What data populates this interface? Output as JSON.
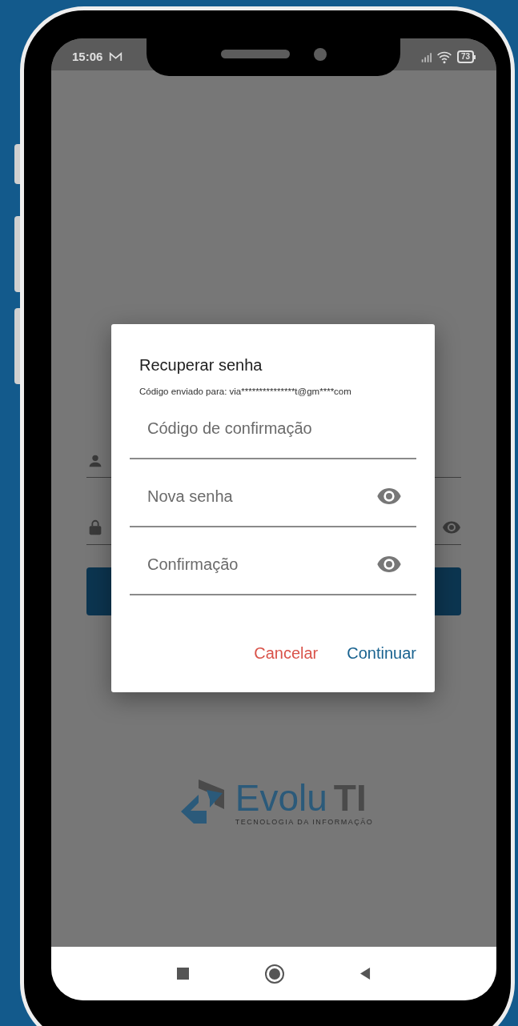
{
  "status_bar": {
    "time": "15:06",
    "battery": "73"
  },
  "dialog": {
    "title": "Recuperar senha",
    "subtitle": "Código enviado para: via***************t@gm****com",
    "fields": [
      {
        "placeholder": "Código de confirmação",
        "kind": "text"
      },
      {
        "placeholder": "Nova senha",
        "kind": "password"
      },
      {
        "placeholder": "Confirmação",
        "kind": "password"
      }
    ],
    "buttons": [
      {
        "label": "Cancelar",
        "kind": "cancel"
      },
      {
        "label": "Continuar",
        "kind": "confirm"
      }
    ]
  },
  "logo": {
    "name": "Evolu",
    "suffix": "TI",
    "tagline": "TECNOLOGIA DA INFORMAÇÃO"
  }
}
